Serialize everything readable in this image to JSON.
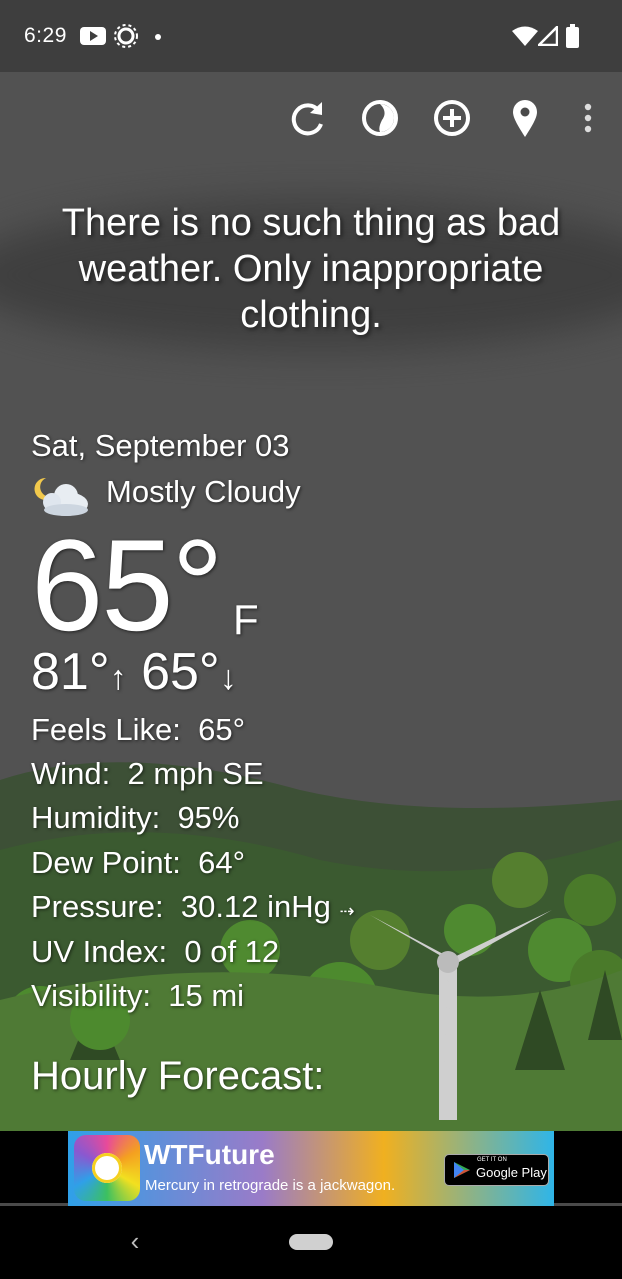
{
  "status_bar": {
    "time": "6:29",
    "icons": [
      "youtube-icon",
      "sun-settings-icon",
      "dot-icon",
      "wifi-icon",
      "cellular-icon",
      "battery-icon"
    ]
  },
  "toolbar": {
    "icons": [
      "refresh-icon",
      "theme-icon",
      "add-location-icon",
      "location-pin-icon",
      "more-vert-icon"
    ]
  },
  "quote": "There is no such thing as bad weather. Only inappropriate clothing.",
  "weather": {
    "date": "Sat, September 03",
    "condition": "Mostly Cloudy",
    "condition_icon": "moon-cloud-icon",
    "temperature": "65°",
    "unit": "F",
    "high": "81°",
    "low": "65°",
    "details": [
      {
        "label": "Feels Like:",
        "value": "65°"
      },
      {
        "label": "Wind:",
        "value": "2 mph SE"
      },
      {
        "label": "Humidity:",
        "value": "95%"
      },
      {
        "label": "Dew Point:",
        "value": "64°"
      },
      {
        "label": "Pressure:",
        "value": "30.12 inHg"
      },
      {
        "label": "UV Index:",
        "value": "0 of 12"
      },
      {
        "label": "Visibility:",
        "value": "15 mi"
      }
    ],
    "hourly_heading": "Hourly Forecast:"
  },
  "ad": {
    "title": "WTFuture",
    "subtitle": "Mercury in retrograde is a jackwagon.",
    "store_get": "GET IT ON",
    "store_name": "Google Play"
  },
  "colors": {
    "sky": "#525252",
    "statusbar": "#3e3e3e",
    "hills": "#3f5a3a",
    "grass": "#4f7a35"
  }
}
